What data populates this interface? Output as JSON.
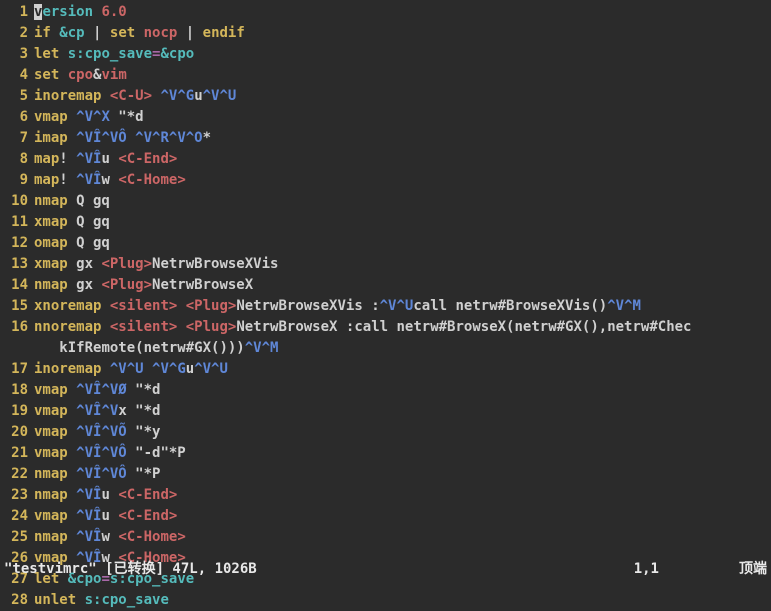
{
  "lines": [
    {
      "n": "1",
      "segs": [
        {
          "t": "version",
          "c": "c-comment"
        },
        {
          "t": " 6.0",
          "c": "c-red"
        }
      ],
      "cursor_at": 0,
      "cursor_ch": "v"
    },
    {
      "n": "2",
      "segs": [
        {
          "t": "if",
          "c": "c-keyword"
        },
        {
          "t": " ",
          "c": ""
        },
        {
          "t": "&cp",
          "c": "c-cyan"
        },
        {
          "t": " | ",
          "c": ""
        },
        {
          "t": "set",
          "c": "c-keyword"
        },
        {
          "t": " ",
          "c": ""
        },
        {
          "t": "nocp",
          "c": "c-red"
        },
        {
          "t": " | ",
          "c": ""
        },
        {
          "t": "endif",
          "c": "c-keyword"
        }
      ]
    },
    {
      "n": "3",
      "segs": [
        {
          "t": "let",
          "c": "c-keyword"
        },
        {
          "t": " ",
          "c": ""
        },
        {
          "t": "s:cpo_save",
          "c": "c-cyan"
        },
        {
          "t": "=",
          "c": "c-purple"
        },
        {
          "t": "&cpo",
          "c": "c-cyan"
        }
      ]
    },
    {
      "n": "4",
      "segs": [
        {
          "t": "set",
          "c": "c-keyword"
        },
        {
          "t": " ",
          "c": ""
        },
        {
          "t": "cpo",
          "c": "c-red"
        },
        {
          "t": "&",
          "c": ""
        },
        {
          "t": "vim",
          "c": "c-red"
        }
      ]
    },
    {
      "n": "5",
      "segs": [
        {
          "t": "inoremap",
          "c": "c-keyword"
        },
        {
          "t": " ",
          "c": ""
        },
        {
          "t": "<C-U>",
          "c": "c-red"
        },
        {
          "t": " ",
          "c": ""
        },
        {
          "t": "^V^G",
          "c": "c-blue"
        },
        {
          "t": "u",
          "c": ""
        },
        {
          "t": "^V^U",
          "c": "c-blue"
        }
      ]
    },
    {
      "n": "6",
      "segs": [
        {
          "t": "vmap",
          "c": "c-keyword"
        },
        {
          "t": " ",
          "c": ""
        },
        {
          "t": "^V^X",
          "c": "c-blue"
        },
        {
          "t": " \"*d",
          "c": ""
        }
      ]
    },
    {
      "n": "7",
      "segs": [
        {
          "t": "imap",
          "c": "c-keyword"
        },
        {
          "t": " ",
          "c": ""
        },
        {
          "t": "^VÎ^VÔ",
          "c": "c-blue"
        },
        {
          "t": " ",
          "c": ""
        },
        {
          "t": "^V^R^V^O",
          "c": "c-blue"
        },
        {
          "t": "*",
          "c": ""
        }
      ]
    },
    {
      "n": "8",
      "segs": [
        {
          "t": "map",
          "c": "c-keyword"
        },
        {
          "t": "! ",
          "c": ""
        },
        {
          "t": "^VÎ",
          "c": "c-blue"
        },
        {
          "t": "u ",
          "c": ""
        },
        {
          "t": "<C-End>",
          "c": "c-red"
        }
      ]
    },
    {
      "n": "9",
      "segs": [
        {
          "t": "map",
          "c": "c-keyword"
        },
        {
          "t": "! ",
          "c": ""
        },
        {
          "t": "^VÎ",
          "c": "c-blue"
        },
        {
          "t": "w ",
          "c": ""
        },
        {
          "t": "<C-Home>",
          "c": "c-red"
        }
      ]
    },
    {
      "n": "10",
      "segs": [
        {
          "t": "nmap",
          "c": "c-keyword"
        },
        {
          "t": " Q gq",
          "c": ""
        }
      ]
    },
    {
      "n": "11",
      "segs": [
        {
          "t": "xmap",
          "c": "c-keyword"
        },
        {
          "t": " Q gq",
          "c": ""
        }
      ]
    },
    {
      "n": "12",
      "segs": [
        {
          "t": "omap",
          "c": "c-keyword"
        },
        {
          "t": " Q gq",
          "c": ""
        }
      ]
    },
    {
      "n": "13",
      "segs": [
        {
          "t": "xmap",
          "c": "c-keyword"
        },
        {
          "t": " gx ",
          "c": ""
        },
        {
          "t": "<Plug>",
          "c": "c-red"
        },
        {
          "t": "NetrwBrowseXVis",
          "c": ""
        }
      ]
    },
    {
      "n": "14",
      "segs": [
        {
          "t": "nmap",
          "c": "c-keyword"
        },
        {
          "t": " gx ",
          "c": ""
        },
        {
          "t": "<Plug>",
          "c": "c-red"
        },
        {
          "t": "NetrwBrowseX",
          "c": ""
        }
      ]
    },
    {
      "n": "15",
      "segs": [
        {
          "t": "xnoremap",
          "c": "c-keyword"
        },
        {
          "t": " ",
          "c": ""
        },
        {
          "t": "<silent>",
          "c": "c-red"
        },
        {
          "t": " ",
          "c": ""
        },
        {
          "t": "<Plug>",
          "c": "c-red"
        },
        {
          "t": "NetrwBrowseXVis :",
          "c": ""
        },
        {
          "t": "^V^U",
          "c": "c-blue"
        },
        {
          "t": "call netrw#BrowseXVis()",
          "c": ""
        },
        {
          "t": "^V^M",
          "c": "c-blue"
        }
      ]
    },
    {
      "n": "16",
      "segs": [
        {
          "t": "nnoremap",
          "c": "c-keyword"
        },
        {
          "t": " ",
          "c": ""
        },
        {
          "t": "<silent>",
          "c": "c-red"
        },
        {
          "t": " ",
          "c": ""
        },
        {
          "t": "<Plug>",
          "c": "c-red"
        },
        {
          "t": "NetrwBrowseX :call netrw#BrowseX(netrw#GX(),netrw#Chec",
          "c": ""
        }
      ]
    },
    {
      "n": "",
      "segs": [
        {
          "t": "kIfRemote(netrw#GX()))",
          "c": ""
        },
        {
          "t": "^V^M",
          "c": "c-blue"
        }
      ],
      "cont": true
    },
    {
      "n": "17",
      "segs": [
        {
          "t": "inoremap",
          "c": "c-keyword"
        },
        {
          "t": " ",
          "c": ""
        },
        {
          "t": "^V^U",
          "c": "c-blue"
        },
        {
          "t": " ",
          "c": ""
        },
        {
          "t": "^V^G",
          "c": "c-blue"
        },
        {
          "t": "u",
          "c": ""
        },
        {
          "t": "^V^U",
          "c": "c-blue"
        }
      ]
    },
    {
      "n": "18",
      "segs": [
        {
          "t": "vmap",
          "c": "c-keyword"
        },
        {
          "t": " ",
          "c": ""
        },
        {
          "t": "^VÎ^VØ",
          "c": "c-blue"
        },
        {
          "t": " \"*d",
          "c": ""
        }
      ]
    },
    {
      "n": "19",
      "segs": [
        {
          "t": "vmap",
          "c": "c-keyword"
        },
        {
          "t": " ",
          "c": ""
        },
        {
          "t": "^VÎ^V",
          "c": "c-blue"
        },
        {
          "t": "x \"*d",
          "c": ""
        }
      ]
    },
    {
      "n": "20",
      "segs": [
        {
          "t": "vmap",
          "c": "c-keyword"
        },
        {
          "t": " ",
          "c": ""
        },
        {
          "t": "^VÎ^VÕ",
          "c": "c-blue"
        },
        {
          "t": " \"*y",
          "c": ""
        }
      ]
    },
    {
      "n": "21",
      "segs": [
        {
          "t": "vmap",
          "c": "c-keyword"
        },
        {
          "t": " ",
          "c": ""
        },
        {
          "t": "^VÎ^VÔ",
          "c": "c-blue"
        },
        {
          "t": " \"-d\"*P",
          "c": ""
        }
      ]
    },
    {
      "n": "22",
      "segs": [
        {
          "t": "nmap",
          "c": "c-keyword"
        },
        {
          "t": " ",
          "c": ""
        },
        {
          "t": "^VÎ^VÔ",
          "c": "c-blue"
        },
        {
          "t": " \"*P",
          "c": ""
        }
      ]
    },
    {
      "n": "23",
      "segs": [
        {
          "t": "nmap",
          "c": "c-keyword"
        },
        {
          "t": " ",
          "c": ""
        },
        {
          "t": "^VÎ",
          "c": "c-blue"
        },
        {
          "t": "u ",
          "c": ""
        },
        {
          "t": "<C-End>",
          "c": "c-red"
        }
      ]
    },
    {
      "n": "24",
      "segs": [
        {
          "t": "vmap",
          "c": "c-keyword"
        },
        {
          "t": " ",
          "c": ""
        },
        {
          "t": "^VÎ",
          "c": "c-blue"
        },
        {
          "t": "u ",
          "c": ""
        },
        {
          "t": "<C-End>",
          "c": "c-red"
        }
      ]
    },
    {
      "n": "25",
      "segs": [
        {
          "t": "nmap",
          "c": "c-keyword"
        },
        {
          "t": " ",
          "c": ""
        },
        {
          "t": "^VÎ",
          "c": "c-blue"
        },
        {
          "t": "w ",
          "c": ""
        },
        {
          "t": "<C-Home>",
          "c": "c-red"
        }
      ]
    },
    {
      "n": "26",
      "segs": [
        {
          "t": "vmap",
          "c": "c-keyword"
        },
        {
          "t": " ",
          "c": ""
        },
        {
          "t": "^VÎ",
          "c": "c-blue"
        },
        {
          "t": "w ",
          "c": ""
        },
        {
          "t": "<C-Home>",
          "c": "c-red"
        }
      ]
    },
    {
      "n": "27",
      "segs": [
        {
          "t": "let",
          "c": "c-keyword"
        },
        {
          "t": " ",
          "c": ""
        },
        {
          "t": "&cpo",
          "c": "c-cyan"
        },
        {
          "t": "=",
          "c": "c-purple"
        },
        {
          "t": "s:cpo_save",
          "c": "c-cyan"
        }
      ]
    },
    {
      "n": "28",
      "segs": [
        {
          "t": "unlet",
          "c": "c-keyword"
        },
        {
          "t": " ",
          "c": ""
        },
        {
          "t": "s:cpo_save",
          "c": "c-cyan"
        }
      ]
    }
  ],
  "status": {
    "filename": "\"testvimrc\" [已转换] 47L, 1026B",
    "pos": "1,1",
    "right": "顶端"
  }
}
